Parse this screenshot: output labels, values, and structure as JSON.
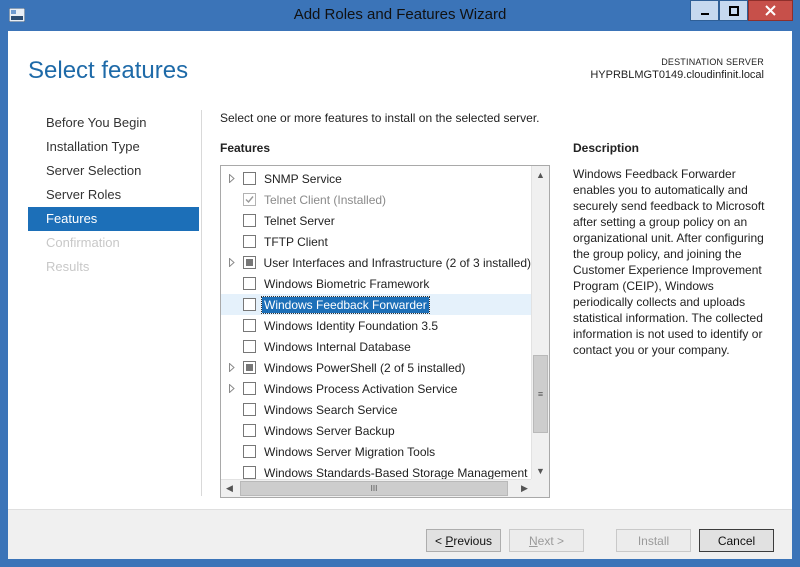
{
  "window": {
    "title": "Add Roles and Features Wizard",
    "controls": {
      "minimize": "▁",
      "maximize": "☐",
      "close": "✕"
    }
  },
  "header": {
    "title": "Select features",
    "destination_label": "DESTINATION SERVER",
    "destination_server": "HYPRBLMGT0149.cloudinfinit.local"
  },
  "nav": {
    "items": [
      {
        "label": "Before You Begin",
        "state": "normal"
      },
      {
        "label": "Installation Type",
        "state": "normal"
      },
      {
        "label": "Server Selection",
        "state": "normal"
      },
      {
        "label": "Server Roles",
        "state": "normal"
      },
      {
        "label": "Features",
        "state": "active"
      },
      {
        "label": "Confirmation",
        "state": "disabled"
      },
      {
        "label": "Results",
        "state": "disabled"
      }
    ]
  },
  "main": {
    "intro": "Select one or more features to install on the selected server.",
    "features_heading": "Features",
    "features": [
      {
        "label": "SNMP Service",
        "expandable": true,
        "check": "unchecked"
      },
      {
        "label": "Telnet Client (Installed)",
        "expandable": false,
        "check": "checked-disabled"
      },
      {
        "label": "Telnet Server",
        "expandable": false,
        "check": "unchecked"
      },
      {
        "label": "TFTP Client",
        "expandable": false,
        "check": "unchecked"
      },
      {
        "label": "User Interfaces and Infrastructure (2 of 3 installed)",
        "expandable": true,
        "check": "partial"
      },
      {
        "label": "Windows Biometric Framework",
        "expandable": false,
        "check": "unchecked"
      },
      {
        "label": "Windows Feedback Forwarder",
        "expandable": false,
        "check": "unchecked",
        "selected": true
      },
      {
        "label": "Windows Identity Foundation 3.5",
        "expandable": false,
        "check": "unchecked"
      },
      {
        "label": "Windows Internal Database",
        "expandable": false,
        "check": "unchecked"
      },
      {
        "label": "Windows PowerShell (2 of 5 installed)",
        "expandable": true,
        "check": "partial"
      },
      {
        "label": "Windows Process Activation Service",
        "expandable": true,
        "check": "unchecked"
      },
      {
        "label": "Windows Search Service",
        "expandable": false,
        "check": "unchecked"
      },
      {
        "label": "Windows Server Backup",
        "expandable": false,
        "check": "unchecked"
      },
      {
        "label": "Windows Server Migration Tools",
        "expandable": false,
        "check": "unchecked"
      },
      {
        "label": "Windows Standards-Based Storage Management",
        "expandable": false,
        "check": "unchecked"
      }
    ],
    "description_heading": "Description",
    "description": "Windows Feedback Forwarder enables you to automatically and securely send feedback to Microsoft after setting a group policy on an organizational unit. After configuring the group policy, and joining the Customer Experience Improvement Program (CEIP), Windows periodically collects and uploads statistical information. The collected information is not used to identify or contact you or your company."
  },
  "scrollbar": {
    "up": "▲",
    "down": "▼",
    "left": "◀",
    "right": "▶",
    "grip_v": "≡",
    "grip_h": "III"
  },
  "footer": {
    "previous": {
      "prefix": "< ",
      "accel": "P",
      "rest": "revious"
    },
    "next": {
      "accel": "N",
      "rest": "ext >"
    },
    "install": "Install",
    "cancel": "Cancel"
  },
  "colors": {
    "accent": "#1c6fb8",
    "title_blue": "#1e6aa8",
    "frame": "#3b74b8",
    "close": "#c7504a"
  }
}
